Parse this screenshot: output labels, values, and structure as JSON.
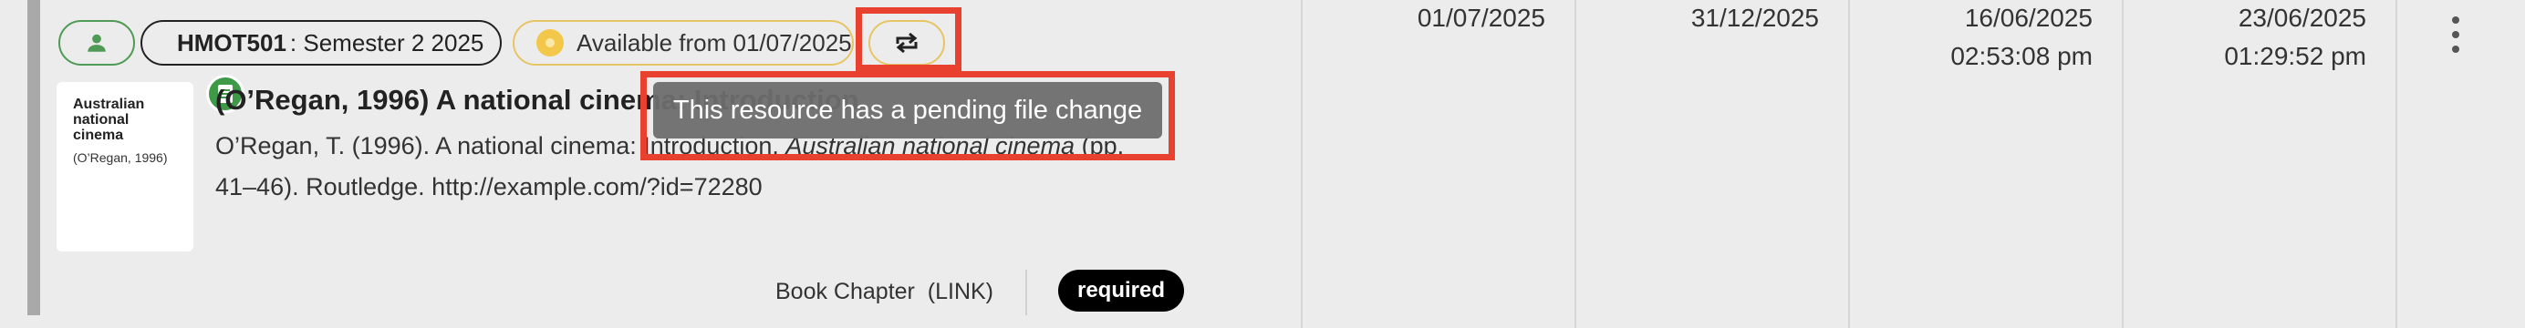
{
  "chips": {
    "course_code": "HMOT501",
    "course_term": ": Semester 2 2025",
    "availability": "Available from 01/07/2025"
  },
  "thumbnail": {
    "title": "Australian national cinema",
    "subtitle": "(O’Regan, 1996)"
  },
  "resource": {
    "title": "(O’Regan, 1996) A national cinema: Introduction",
    "citation_before": "O’Regan, T. (1996). A national cinema: Introduction. ",
    "citation_italic": "Australian national cinema",
    "citation_after": " (pp. 41–46). Routledge. http://example.com/?id=72280",
    "type": "Book Chapter",
    "link_label": "(LINK)",
    "status": "required"
  },
  "tooltip": "This resource has a pending file change",
  "dates": {
    "start": "01/07/2025",
    "end": "31/12/2025",
    "created_date": "16/06/2025",
    "created_time": "02:53:08 pm",
    "updated_date": "23/06/2025",
    "updated_time": "01:29:52 pm"
  },
  "colors": {
    "accent_green": "#3e9a47",
    "availability_yellow": "#f3c84a",
    "highlight_red": "#e8412f"
  }
}
